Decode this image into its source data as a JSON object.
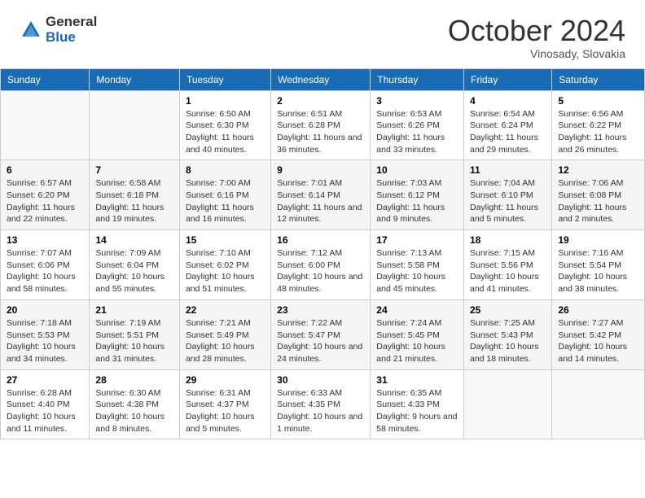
{
  "header": {
    "logo_general": "General",
    "logo_blue": "Blue",
    "month": "October 2024",
    "location": "Vinosady, Slovakia"
  },
  "days_of_week": [
    "Sunday",
    "Monday",
    "Tuesday",
    "Wednesday",
    "Thursday",
    "Friday",
    "Saturday"
  ],
  "weeks": [
    [
      {
        "day": "",
        "sunrise": "",
        "sunset": "",
        "daylight": ""
      },
      {
        "day": "",
        "sunrise": "",
        "sunset": "",
        "daylight": ""
      },
      {
        "day": "1",
        "sunrise": "Sunrise: 6:50 AM",
        "sunset": "Sunset: 6:30 PM",
        "daylight": "Daylight: 11 hours and 40 minutes."
      },
      {
        "day": "2",
        "sunrise": "Sunrise: 6:51 AM",
        "sunset": "Sunset: 6:28 PM",
        "daylight": "Daylight: 11 hours and 36 minutes."
      },
      {
        "day": "3",
        "sunrise": "Sunrise: 6:53 AM",
        "sunset": "Sunset: 6:26 PM",
        "daylight": "Daylight: 11 hours and 33 minutes."
      },
      {
        "day": "4",
        "sunrise": "Sunrise: 6:54 AM",
        "sunset": "Sunset: 6:24 PM",
        "daylight": "Daylight: 11 hours and 29 minutes."
      },
      {
        "day": "5",
        "sunrise": "Sunrise: 6:56 AM",
        "sunset": "Sunset: 6:22 PM",
        "daylight": "Daylight: 11 hours and 26 minutes."
      }
    ],
    [
      {
        "day": "6",
        "sunrise": "Sunrise: 6:57 AM",
        "sunset": "Sunset: 6:20 PM",
        "daylight": "Daylight: 11 hours and 22 minutes."
      },
      {
        "day": "7",
        "sunrise": "Sunrise: 6:58 AM",
        "sunset": "Sunset: 6:18 PM",
        "daylight": "Daylight: 11 hours and 19 minutes."
      },
      {
        "day": "8",
        "sunrise": "Sunrise: 7:00 AM",
        "sunset": "Sunset: 6:16 PM",
        "daylight": "Daylight: 11 hours and 16 minutes."
      },
      {
        "day": "9",
        "sunrise": "Sunrise: 7:01 AM",
        "sunset": "Sunset: 6:14 PM",
        "daylight": "Daylight: 11 hours and 12 minutes."
      },
      {
        "day": "10",
        "sunrise": "Sunrise: 7:03 AM",
        "sunset": "Sunset: 6:12 PM",
        "daylight": "Daylight: 11 hours and 9 minutes."
      },
      {
        "day": "11",
        "sunrise": "Sunrise: 7:04 AM",
        "sunset": "Sunset: 6:10 PM",
        "daylight": "Daylight: 11 hours and 5 minutes."
      },
      {
        "day": "12",
        "sunrise": "Sunrise: 7:06 AM",
        "sunset": "Sunset: 6:08 PM",
        "daylight": "Daylight: 11 hours and 2 minutes."
      }
    ],
    [
      {
        "day": "13",
        "sunrise": "Sunrise: 7:07 AM",
        "sunset": "Sunset: 6:06 PM",
        "daylight": "Daylight: 10 hours and 58 minutes."
      },
      {
        "day": "14",
        "sunrise": "Sunrise: 7:09 AM",
        "sunset": "Sunset: 6:04 PM",
        "daylight": "Daylight: 10 hours and 55 minutes."
      },
      {
        "day": "15",
        "sunrise": "Sunrise: 7:10 AM",
        "sunset": "Sunset: 6:02 PM",
        "daylight": "Daylight: 10 hours and 51 minutes."
      },
      {
        "day": "16",
        "sunrise": "Sunrise: 7:12 AM",
        "sunset": "Sunset: 6:00 PM",
        "daylight": "Daylight: 10 hours and 48 minutes."
      },
      {
        "day": "17",
        "sunrise": "Sunrise: 7:13 AM",
        "sunset": "Sunset: 5:58 PM",
        "daylight": "Daylight: 10 hours and 45 minutes."
      },
      {
        "day": "18",
        "sunrise": "Sunrise: 7:15 AM",
        "sunset": "Sunset: 5:56 PM",
        "daylight": "Daylight: 10 hours and 41 minutes."
      },
      {
        "day": "19",
        "sunrise": "Sunrise: 7:16 AM",
        "sunset": "Sunset: 5:54 PM",
        "daylight": "Daylight: 10 hours and 38 minutes."
      }
    ],
    [
      {
        "day": "20",
        "sunrise": "Sunrise: 7:18 AM",
        "sunset": "Sunset: 5:53 PM",
        "daylight": "Daylight: 10 hours and 34 minutes."
      },
      {
        "day": "21",
        "sunrise": "Sunrise: 7:19 AM",
        "sunset": "Sunset: 5:51 PM",
        "daylight": "Daylight: 10 hours and 31 minutes."
      },
      {
        "day": "22",
        "sunrise": "Sunrise: 7:21 AM",
        "sunset": "Sunset: 5:49 PM",
        "daylight": "Daylight: 10 hours and 28 minutes."
      },
      {
        "day": "23",
        "sunrise": "Sunrise: 7:22 AM",
        "sunset": "Sunset: 5:47 PM",
        "daylight": "Daylight: 10 hours and 24 minutes."
      },
      {
        "day": "24",
        "sunrise": "Sunrise: 7:24 AM",
        "sunset": "Sunset: 5:45 PM",
        "daylight": "Daylight: 10 hours and 21 minutes."
      },
      {
        "day": "25",
        "sunrise": "Sunrise: 7:25 AM",
        "sunset": "Sunset: 5:43 PM",
        "daylight": "Daylight: 10 hours and 18 minutes."
      },
      {
        "day": "26",
        "sunrise": "Sunrise: 7:27 AM",
        "sunset": "Sunset: 5:42 PM",
        "daylight": "Daylight: 10 hours and 14 minutes."
      }
    ],
    [
      {
        "day": "27",
        "sunrise": "Sunrise: 6:28 AM",
        "sunset": "Sunset: 4:40 PM",
        "daylight": "Daylight: 10 hours and 11 minutes."
      },
      {
        "day": "28",
        "sunrise": "Sunrise: 6:30 AM",
        "sunset": "Sunset: 4:38 PM",
        "daylight": "Daylight: 10 hours and 8 minutes."
      },
      {
        "day": "29",
        "sunrise": "Sunrise: 6:31 AM",
        "sunset": "Sunset: 4:37 PM",
        "daylight": "Daylight: 10 hours and 5 minutes."
      },
      {
        "day": "30",
        "sunrise": "Sunrise: 6:33 AM",
        "sunset": "Sunset: 4:35 PM",
        "daylight": "Daylight: 10 hours and 1 minute."
      },
      {
        "day": "31",
        "sunrise": "Sunrise: 6:35 AM",
        "sunset": "Sunset: 4:33 PM",
        "daylight": "Daylight: 9 hours and 58 minutes."
      },
      {
        "day": "",
        "sunrise": "",
        "sunset": "",
        "daylight": ""
      },
      {
        "day": "",
        "sunrise": "",
        "sunset": "",
        "daylight": ""
      }
    ]
  ]
}
